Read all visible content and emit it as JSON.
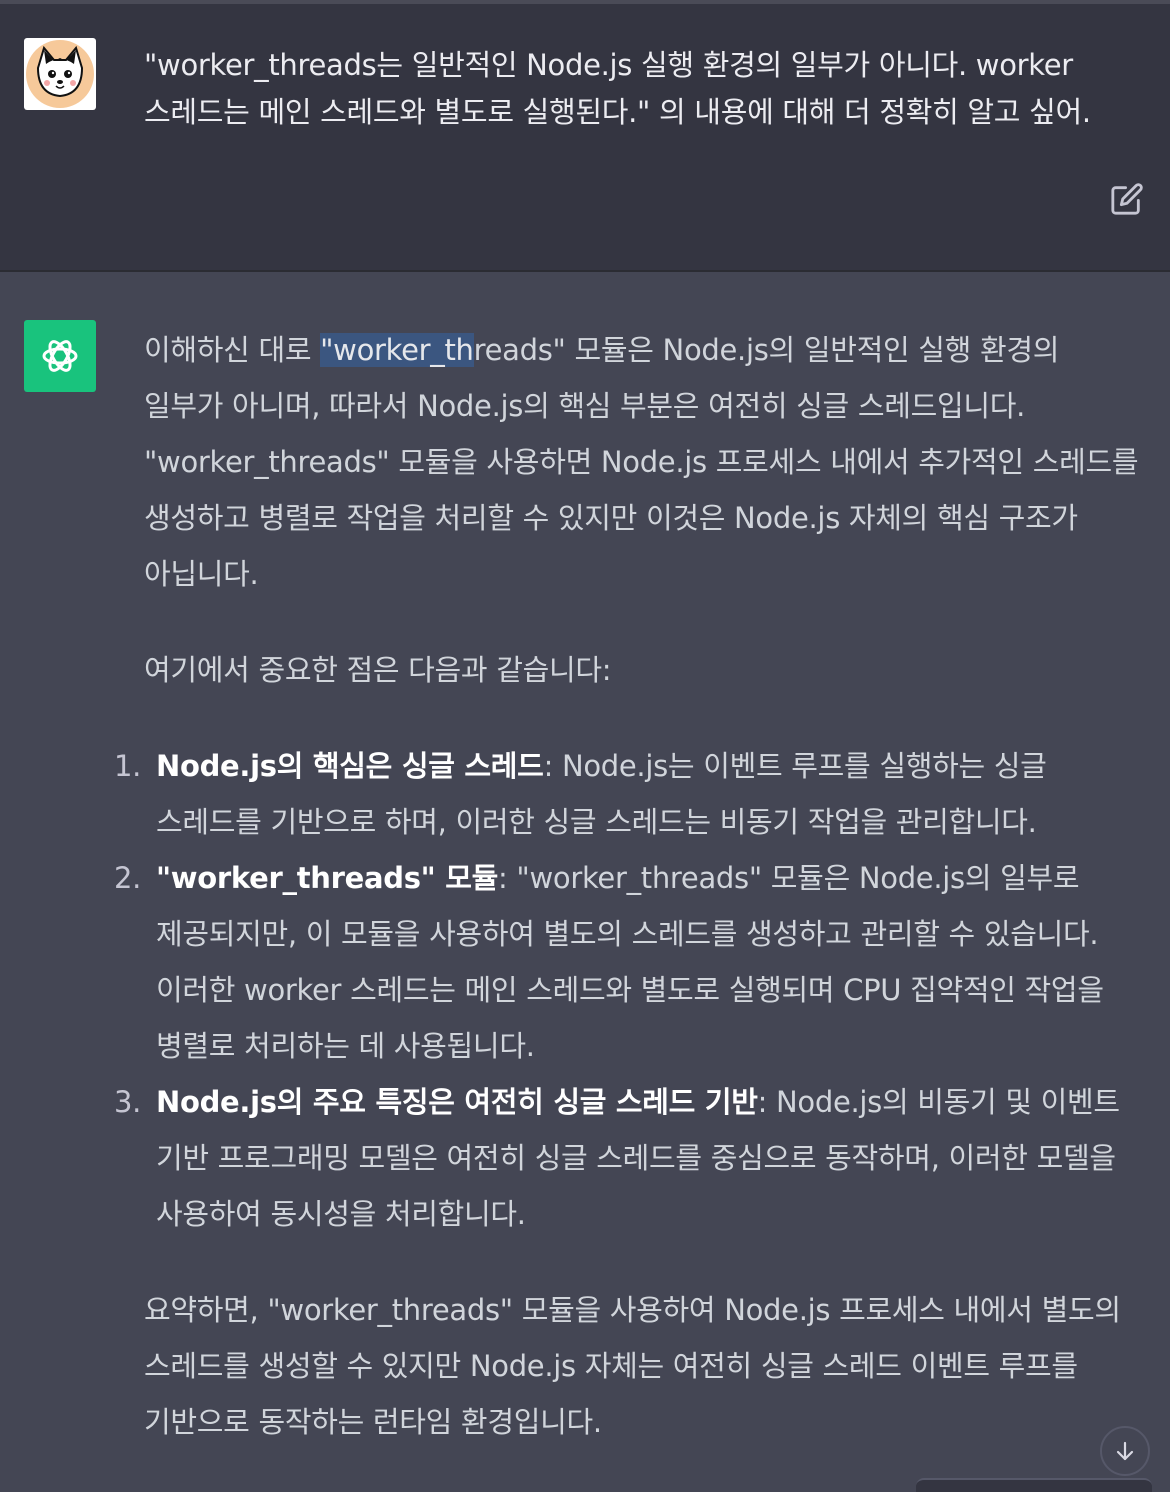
{
  "user_message": {
    "text": "\"worker_threads는 일반적인 Node.js 실행 환경의 일부가 아니다. worker 스레드는 메인 스레드와 별도로 실행된다.\" 의 내용에 대해 더 정확히 알고 싶어."
  },
  "assistant_message": {
    "intro_before": "이해하신 대로 ",
    "intro_highlight": "\"worker_th",
    "intro_after": "reads\" 모듈은 Node.js의 일반적인 실행 환경의 일부가 아니며, 따라서 Node.js의 핵심 부분은 여전히 싱글 스레드입니다. \"worker_threads\" 모듈을 사용하면 Node.js 프로세스 내에서 추가적인 스레드를 생성하고 병렬로 작업을 처리할 수 있지만 이것은 Node.js 자체의 핵심 구조가 아닙니다.",
    "lead": "여기에서 중요한 점은 다음과 같습니다:",
    "items": [
      {
        "number": "1.",
        "title": "Node.js의 핵심은 싱글 스레드",
        "body": ": Node.js는 이벤트 루프를 실행하는 싱글 스레드를 기반으로 하며, 이러한 싱글 스레드는 비동기 작업을 관리합니다."
      },
      {
        "number": "2.",
        "title": "\"worker_threads\" 모듈",
        "body": ": \"worker_threads\" 모듈은 Node.js의 일부로 제공되지만, 이 모듈을 사용하여 별도의 스레드를 생성하고 관리할 수 있습니다. 이러한 worker 스레드는 메인 스레드와 별도로 실행되며 CPU 집약적인 작업을 병렬로 처리하는 데 사용됩니다."
      },
      {
        "number": "3.",
        "title": "Node.js의 주요 특징은 여전히 싱글 스레드 기반",
        "body": ": Node.js의 비동기 및 이벤트 기반 프로그래밍 모델은 여전히 싱글 스레드를 중심으로 동작하며, 이러한 모델을 사용하여 동시성을 처리합니다."
      }
    ],
    "summary": "요약하면, \"worker_threads\" 모듈을 사용하여 Node.js 프로세스 내에서 별도의 스레드를 생성할 수 있지만 Node.js 자체는 여전히 싱글 스레드 이벤트 루프를 기반으로 동작하는 런타임 환경입니다."
  },
  "icons": {
    "user_avatar": "cat-avatar",
    "assistant_avatar": "openai-logo-icon",
    "edit": "edit-icon",
    "scroll_down": "arrow-down-icon"
  },
  "colors": {
    "user_bg": "#343541",
    "assistant_bg": "#444654",
    "bot_avatar_bg": "#19c37d",
    "highlight": "#3b5680"
  }
}
